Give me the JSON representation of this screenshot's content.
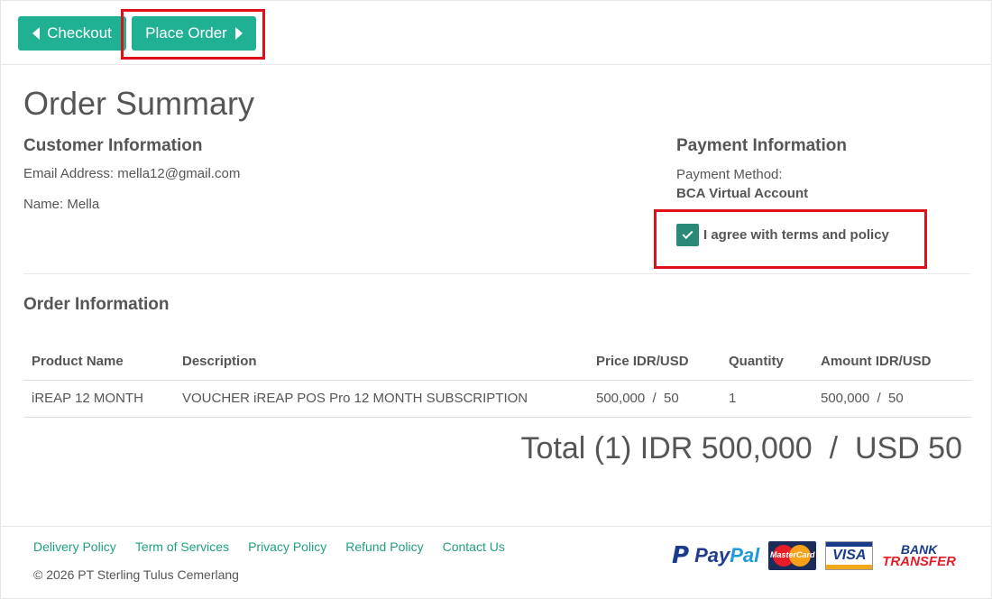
{
  "toolbar": {
    "checkout_label": "Checkout",
    "place_order_label": "Place Order"
  },
  "page": {
    "title": "Order Summary"
  },
  "customer": {
    "heading": "Customer Information",
    "email": "Email Address: mella12@gmail.com",
    "name": "Name: Mella"
  },
  "payment": {
    "heading": "Payment Information",
    "method_label": "Payment Method:",
    "method_value": "BCA Virtual Account",
    "agree_label": "I agree with terms and policy",
    "agree_checked": true
  },
  "order": {
    "heading": "Order Information",
    "columns": [
      "Product Name",
      "Description",
      "Price IDR/USD",
      "Quantity",
      "Amount IDR/USD"
    ],
    "rows": [
      [
        "iREAP 12 MONTH",
        "VOUCHER iREAP POS Pro 12 MONTH SUBSCRIPTION",
        "500,000  /  50",
        "1",
        "500,000  /  50"
      ]
    ],
    "total": "Total (1) IDR 500,000  /  USD 50"
  },
  "footer": {
    "links": [
      "Delivery Policy",
      "Term of Services",
      "Privacy Policy",
      "Refund Policy",
      "Contact Us"
    ],
    "copyright": "© 2026 PT Sterling Tulus Cemerlang",
    "payment_logos": {
      "paypal_pay": "Pay",
      "paypal_pal": "Pal",
      "mastercard": "MasterCard",
      "visa": "VISA",
      "bank_line1": "BANK",
      "bank_line2": "TRANSFER"
    }
  },
  "colors": {
    "accent": "#20b093",
    "highlight": "#e0101a",
    "checkbox": "#2a8a78"
  }
}
